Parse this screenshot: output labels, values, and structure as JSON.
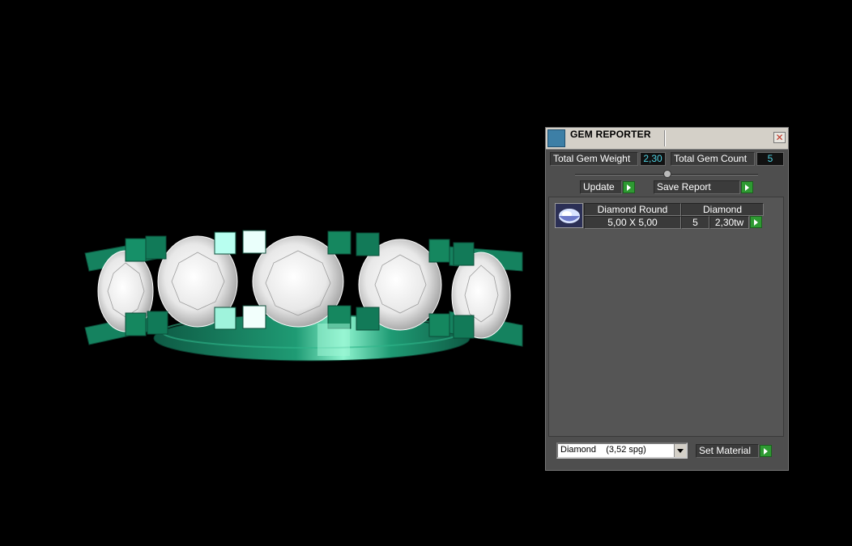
{
  "panel": {
    "title": "GEM REPORTER",
    "close_label": "x",
    "total_weight_label": "Total Gem Weight",
    "total_weight_value": "2,30",
    "total_count_label": "Total Gem Count",
    "total_count_value": "5",
    "update_label": "Update",
    "save_report_label": "Save Report",
    "gem_row": {
      "shape": "Diamond Round",
      "material": "Diamond",
      "size": "5,00 X 5,00",
      "count": "5",
      "weight": "2,30tw"
    },
    "material_select_value": "Diamond    (3,52 spg)",
    "set_material_label": "Set Material"
  },
  "colors": {
    "metal": "#1a8f6a",
    "metal_light": "#6fe8c2",
    "gem": "#ffffff",
    "accent_value": "#4fd0e0",
    "button_arrow": "#2e9a32"
  }
}
